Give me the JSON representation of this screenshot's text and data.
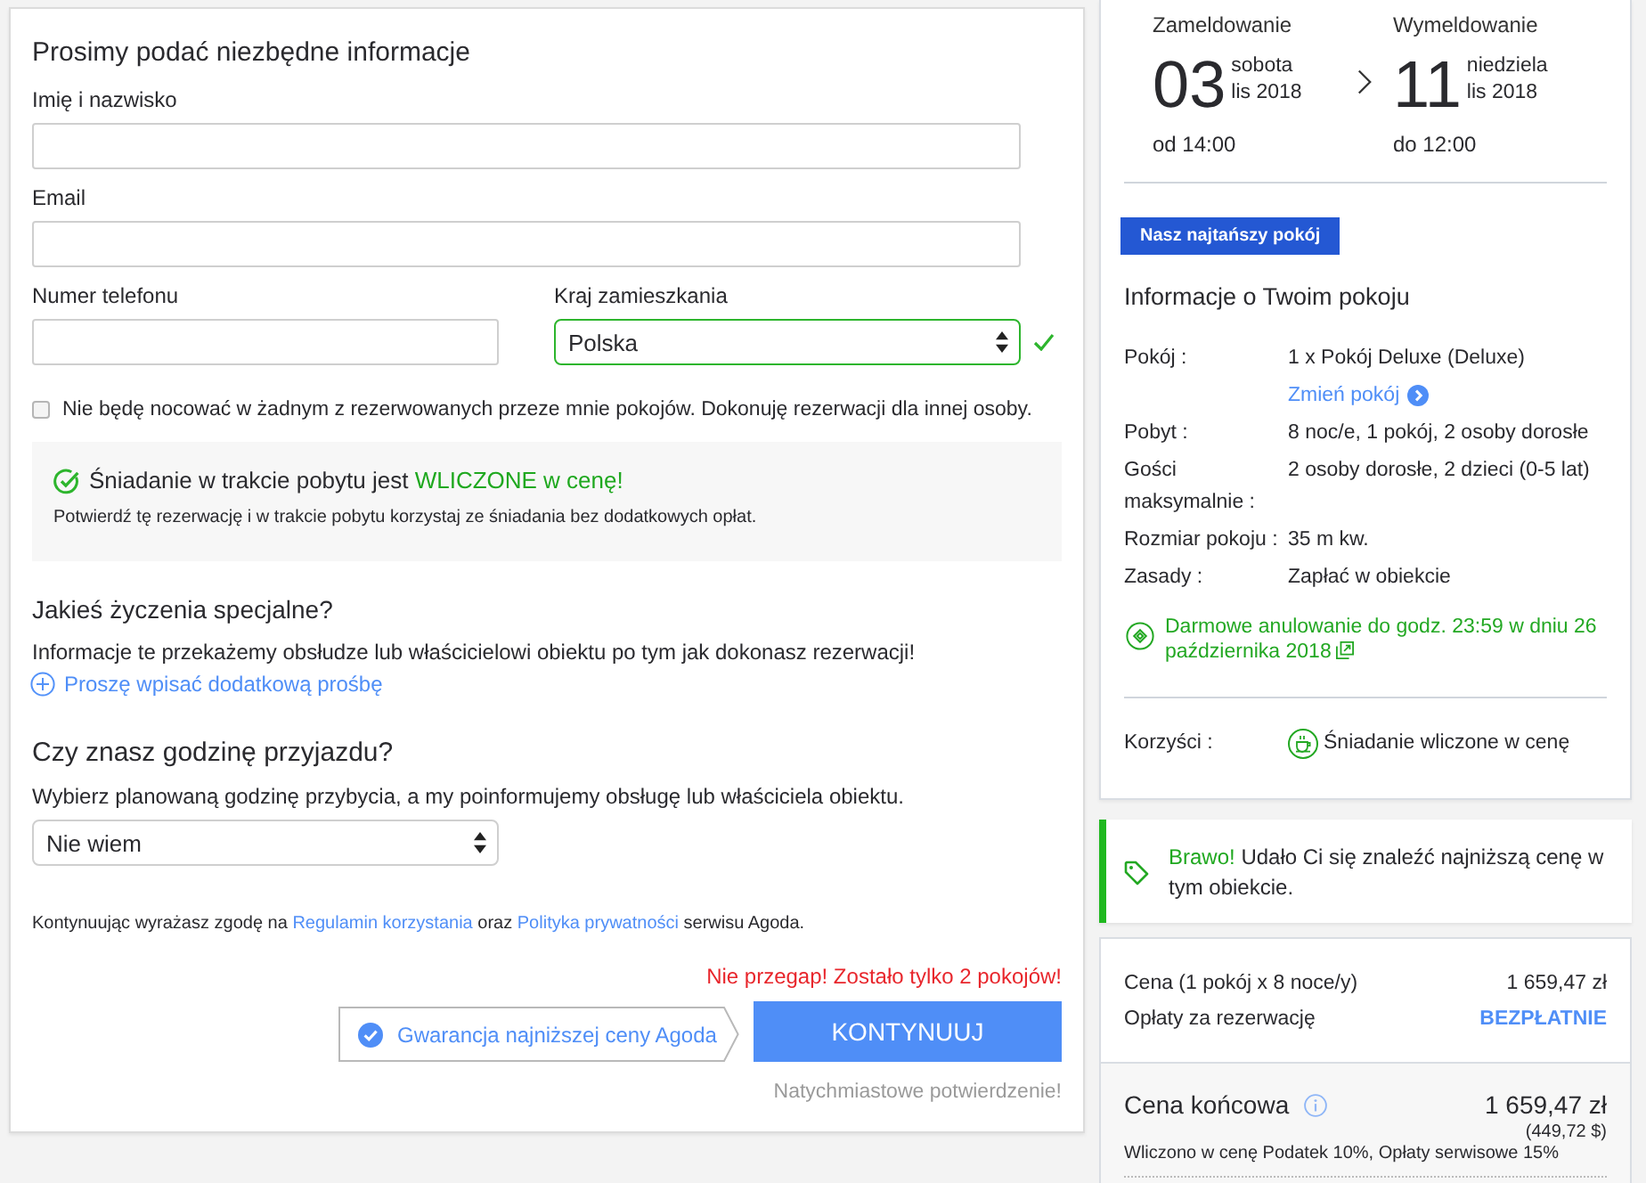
{
  "form": {
    "title": "Prosimy podać niezbędne informacje",
    "name_field": {
      "label": "Imię i nazwisko"
    },
    "email_field": {
      "label": "Email"
    },
    "phone_field": {
      "label": "Numer telefonu"
    },
    "country_field": {
      "label": "Kraj zamieszkania",
      "value": "Polska",
      "valid": true
    },
    "other_guest": {
      "label": "Nie będę nocować w żadnym z rezerwowanych przeze mnie pokojów. Dokonuję rezerwacji dla innej osoby.",
      "checked": false
    },
    "breakfast_notice": {
      "text": "Śniadanie w trakcie pobytu jest",
      "highlight": "WLICZONE w cenę!",
      "subtext": "Potwierdź tę rezerwację i w trakcie pobytu korzystaj ze śniadania bez dodatkowych opłat."
    },
    "special_requests": {
      "title": "Jakieś życzenia specjalne?",
      "text": "Informacje te przekażemy obsłudze lub właścicielowi obiektu po tym jak dokonasz rezerwacji!",
      "link": "Proszę wpisać dodatkową prośbę"
    },
    "arrival": {
      "title": "Czy znasz godzinę przyjazdu?",
      "text": "Wybierz planowaną godzinę przybycia, a my poinformujemy obsługę lub właściciela obiektu.",
      "value": "Nie wiem"
    },
    "consent": [
      {
        "kind": "text",
        "text": "Kontynuując wyrażasz zgodę na"
      },
      {
        "kind": "link",
        "text": "Regulamin korzystania"
      },
      {
        "kind": "text",
        "text": "oraz"
      },
      {
        "kind": "link",
        "text": "Polityka prywatności"
      },
      {
        "kind": "text",
        "text": "serwisu Agoda."
      }
    ],
    "urgency": "Nie przegap! Zostało tylko 2 pokojów!",
    "guarantee": "Gwarancja najniższej ceny Agoda",
    "continue_button": "KONTYNUUJ",
    "confirmation": "Natychmiastowe potwierdzenie!"
  },
  "stay": {
    "check_in": {
      "label": "Zameldowanie",
      "day": "03",
      "weekday": "sobota",
      "month": "lis 2018",
      "time": "od 14:00"
    },
    "check_out": {
      "label": "Wymeldowanie",
      "day": "11",
      "weekday": "niedziela",
      "month": "lis 2018",
      "time": "do 12:00"
    }
  },
  "room_info": {
    "badge": "Nasz najtańszy pokój",
    "title": "Informacje o Twoim pokoju",
    "rows": [
      {
        "label": "Pokój :",
        "value": "1 x Pokój Deluxe (Deluxe)",
        "link": "Zmień pokój"
      },
      {
        "label": "Pobyt :",
        "value": "8 noc/e, 1 pokój, 2 osoby dorosłe"
      },
      {
        "label": "Gości maksymalnie :",
        "value": "2 osoby dorosłe, 2 dzieci (0-5 lat)"
      },
      {
        "label": "Rozmiar pokoju :",
        "value": "35 m kw."
      },
      {
        "label": "Zasady :",
        "value": "Zapłać w obiekcie"
      }
    ],
    "cancellation": "Darmowe anulowanie do godz. 23:59 w dniu 26 października 2018",
    "benefits": {
      "label": "Korzyści :",
      "items": [
        "Śniadanie wliczone w cenę"
      ]
    }
  },
  "promo": {
    "highlight": "Brawo!",
    "text": "Udało Ci się znaleźć najniższą cenę w tym obiekcie."
  },
  "price": {
    "rows": [
      {
        "label": "Cena (1 pokój x 8 noce/y)",
        "value": "1 659,47 zł",
        "kind": "amount"
      },
      {
        "label": "Opłaty za rezerwację",
        "value": "BEZPŁATNIE",
        "kind": "free"
      }
    ],
    "total_label": "Cena końcowa",
    "total": "1 659,47 zł",
    "total_usd": "(449,72 $)",
    "taxes_note": "Wliczono w cenę Podatek 10%, Opłaty serwisowe 15%"
  }
}
